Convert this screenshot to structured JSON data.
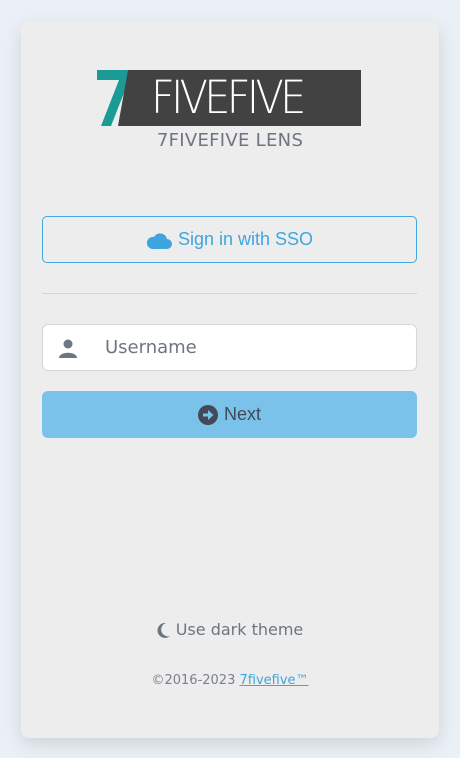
{
  "brand": {
    "logo_text": "FIVEFIVE",
    "logo_numeral": "7",
    "app_name": "7FIVEFIVE LENS",
    "accent_teal": "#1a9b95",
    "logo_dark": "#424242"
  },
  "sso": {
    "label": "Sign in with SSO",
    "icon": "cloud-icon",
    "color": "#3fa5df"
  },
  "login": {
    "username_placeholder": "Username",
    "username_value": "",
    "username_icon": "user-icon",
    "next_label": "Next",
    "next_icon": "arrow-circle-right-icon",
    "next_bg": "#7ac2ea"
  },
  "theme": {
    "label": "Use dark theme",
    "icon": "moon-icon"
  },
  "footer": {
    "copyright": "©2016-2023",
    "link_text": "7fivefive™"
  }
}
